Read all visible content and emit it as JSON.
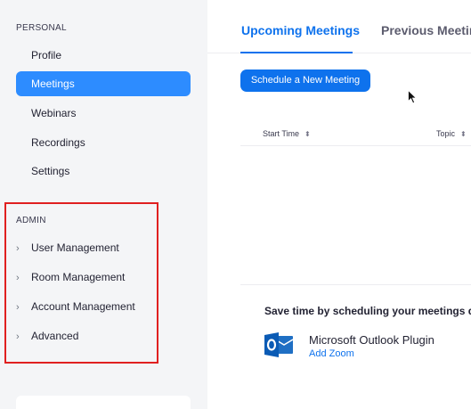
{
  "sidebar": {
    "personal_title": "PERSONAL",
    "personal_items": [
      {
        "label": "Profile",
        "active": false
      },
      {
        "label": "Meetings",
        "active": true
      },
      {
        "label": "Webinars",
        "active": false
      },
      {
        "label": "Recordings",
        "active": false
      },
      {
        "label": "Settings",
        "active": false
      }
    ],
    "admin_title": "ADMIN",
    "admin_items": [
      {
        "label": "User Management",
        "icon": "chevron-right-icon"
      },
      {
        "label": "Room Management",
        "icon": "chevron-right-icon"
      },
      {
        "label": "Account Management",
        "icon": "chevron-right-icon"
      },
      {
        "label": "Advanced",
        "icon": "chevron-right-icon"
      }
    ]
  },
  "tabs": {
    "upcoming": "Upcoming Meetings",
    "previous": "Previous Meetin"
  },
  "schedule_button": "Schedule a New Meeting",
  "table": {
    "columns": [
      "Start Time",
      "Topic"
    ],
    "sort_icon": "sort-icon"
  },
  "promo": {
    "title": "Save time by scheduling your meetings dir",
    "plugin_name": "Microsoft Outlook Plugin",
    "plugin_link": "Add Zoom",
    "icon": "outlook-icon"
  },
  "colors": {
    "accent": "#0e72ed",
    "active_nav": "#2d8cff",
    "highlight_box": "#e02020",
    "sidebar_bg": "#f4f5f7"
  }
}
